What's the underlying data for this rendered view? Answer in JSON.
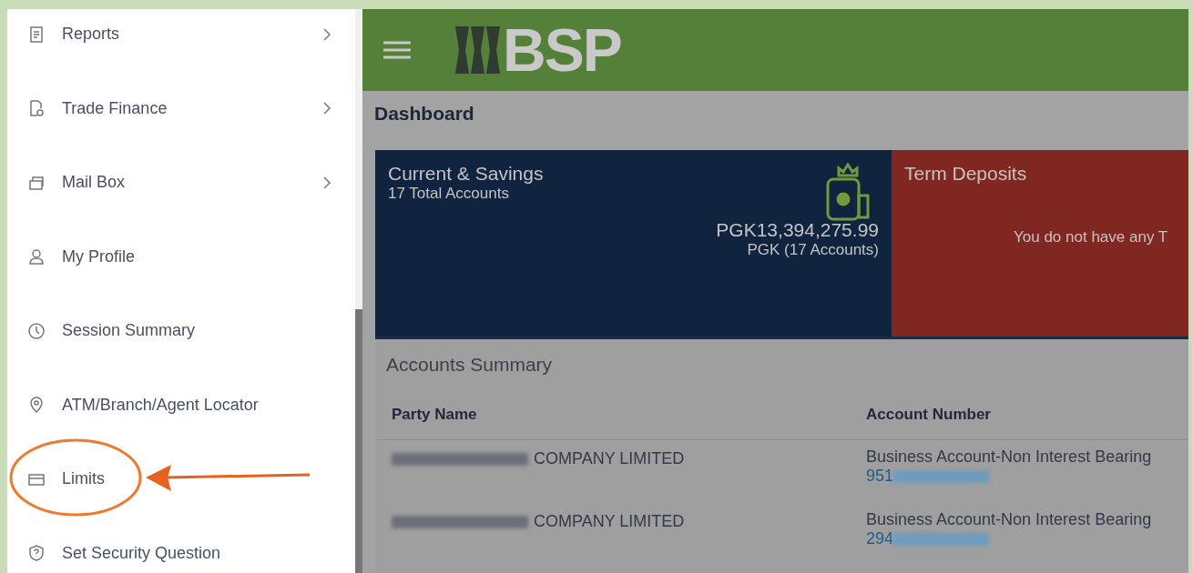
{
  "sidebar": {
    "items": [
      {
        "label": "Reports",
        "has_submenu": true
      },
      {
        "label": "Trade Finance",
        "has_submenu": true
      },
      {
        "label": "Mail Box",
        "has_submenu": true
      },
      {
        "label": "My Profile",
        "has_submenu": false
      },
      {
        "label": "Session Summary",
        "has_submenu": false
      },
      {
        "label": "ATM/Branch/Agent Locator",
        "has_submenu": false
      },
      {
        "label": "Limits",
        "has_submenu": false
      },
      {
        "label": "Set Security Question",
        "has_submenu": false
      }
    ]
  },
  "header": {
    "logo_text": "BSP"
  },
  "page_title": "Dashboard",
  "cards": [
    {
      "kind": "summary",
      "title": "Current & Savings",
      "subtitle": "17 Total Accounts",
      "amount": "PGK13,394,275.99",
      "amount_note": "PGK (17 Accounts)"
    },
    {
      "kind": "empty",
      "title": "Term Deposits",
      "message": "You do not have any T"
    }
  ],
  "accounts_summary": {
    "title": "Accounts Summary",
    "columns": [
      "Party Name",
      "Account Number"
    ],
    "rows": [
      {
        "party_name": "COMPANY LIMITED",
        "account_type": "Business Account-Non Interest Bearing",
        "account_number": "951"
      },
      {
        "party_name": "COMPANY LIMITED",
        "account_type": "Business Account-Non Interest Bearing",
        "account_number": "294"
      }
    ]
  }
}
